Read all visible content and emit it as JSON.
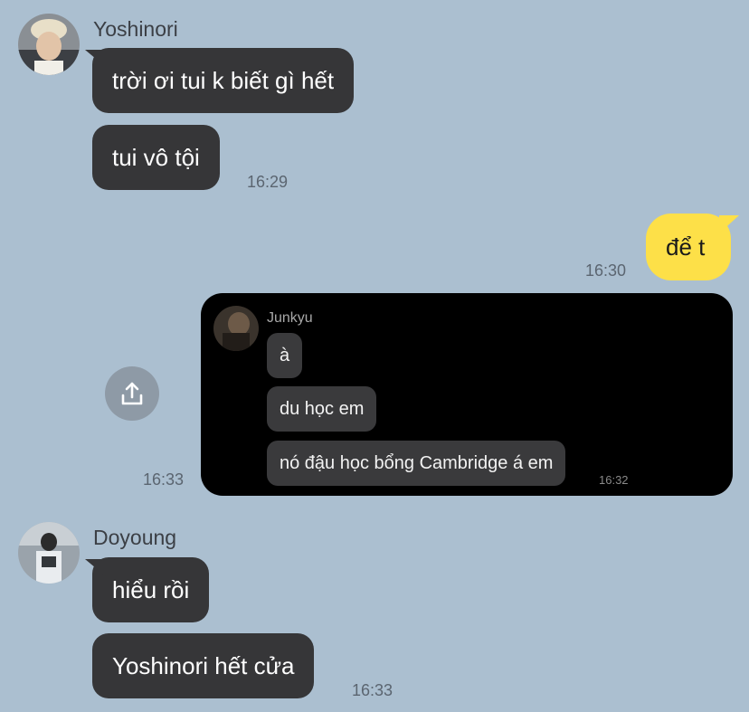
{
  "colors": {
    "background": "#abbfd0",
    "other_bubble": "#363638",
    "my_bubble": "#fde048",
    "shared_card": "#000000"
  },
  "messages": {
    "yoshinori": {
      "name": "Yoshinori",
      "bubbles": [
        "trời ơi tui k biết gì hết",
        "tui vô tội"
      ],
      "time": "16:29"
    },
    "me": {
      "bubble": "để t",
      "time": "16:30"
    },
    "shared": {
      "time": "16:33",
      "icon": "share-upload-icon",
      "inner": {
        "name": "Junkyu",
        "bubbles": [
          "à",
          "du học em",
          "nó đậu học bổng Cambridge á em"
        ],
        "time": "16:32"
      }
    },
    "doyoung": {
      "name": "Doyoung",
      "bubbles": [
        "hiểu rồi",
        "Yoshinori hết cửa"
      ],
      "time": "16:33"
    }
  }
}
